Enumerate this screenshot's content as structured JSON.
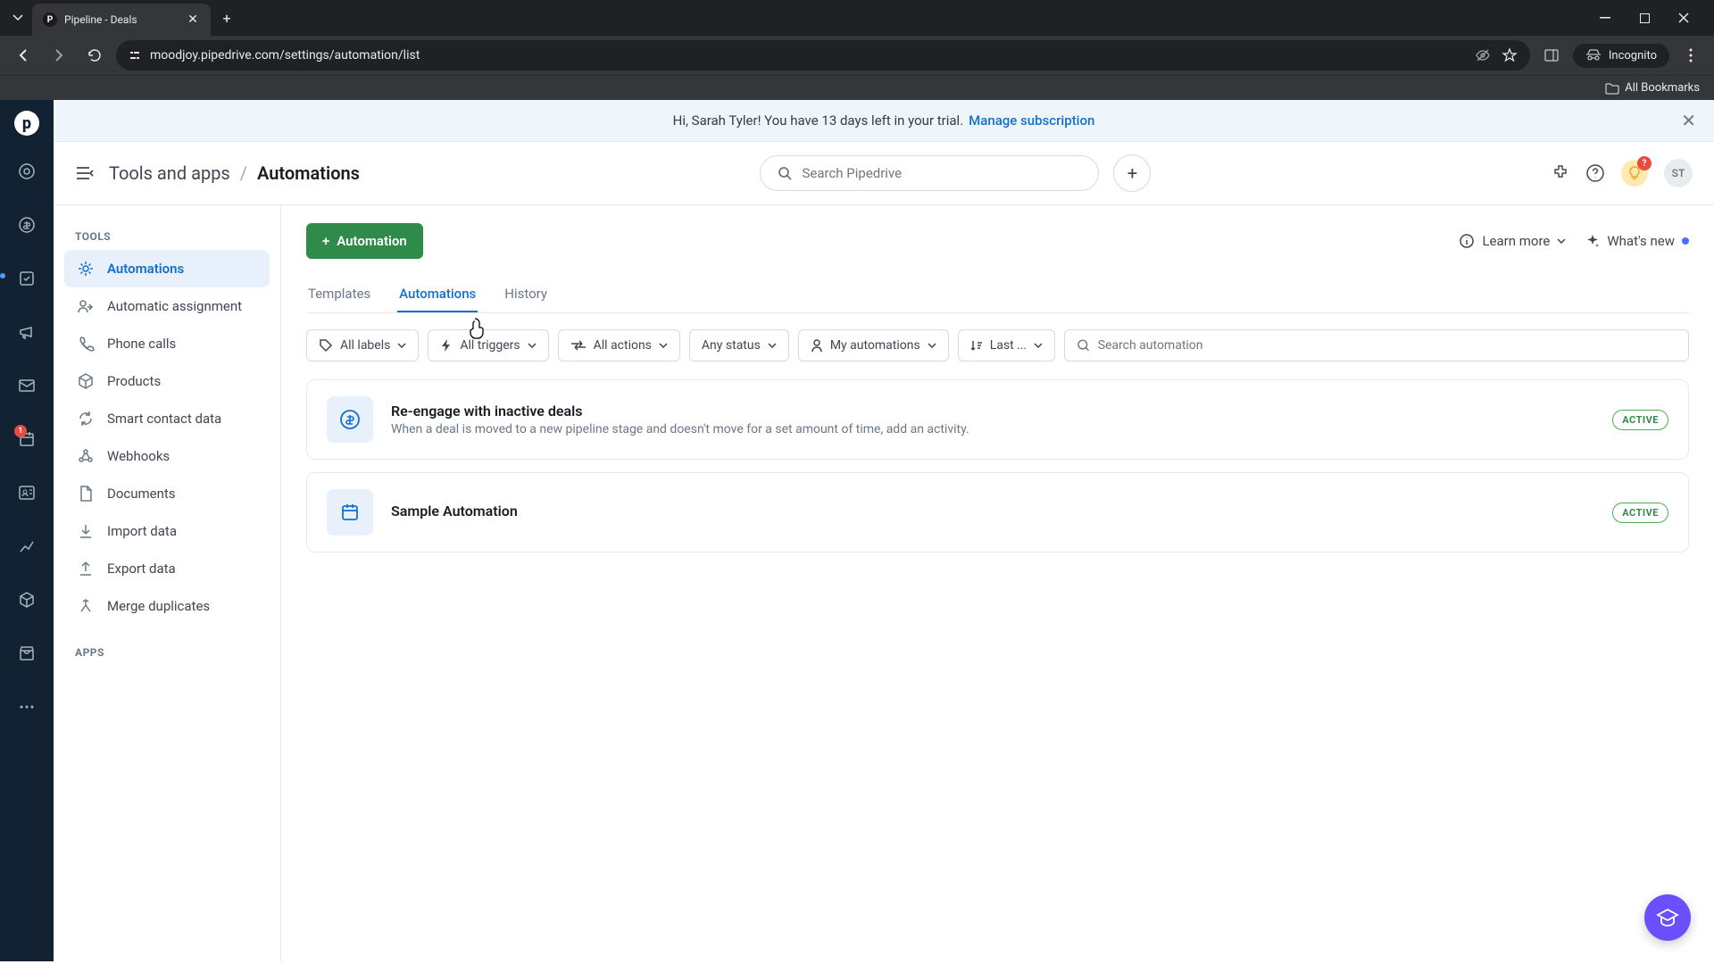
{
  "browser": {
    "tab_title": "Pipeline - Deals",
    "url": "moodjoy.pipedrive.com/settings/automation/list",
    "incognito_label": "Incognito",
    "bookmarks_label": "All Bookmarks"
  },
  "banner": {
    "text": "Hi, Sarah Tyler! You have 13 days left in your trial.",
    "link": "Manage subscription"
  },
  "topbar": {
    "breadcrumb_parent": "Tools and apps",
    "breadcrumb_current": "Automations",
    "search_placeholder": "Search Pipedrive",
    "avatar": "ST",
    "bulb_badge": "?"
  },
  "rail": {
    "badge_count": "1"
  },
  "sidebar": {
    "section_tools": "TOOLS",
    "section_apps": "APPS",
    "items": [
      {
        "label": "Automations"
      },
      {
        "label": "Automatic assignment"
      },
      {
        "label": "Phone calls"
      },
      {
        "label": "Products"
      },
      {
        "label": "Smart contact data"
      },
      {
        "label": "Webhooks"
      },
      {
        "label": "Documents"
      },
      {
        "label": "Import data"
      },
      {
        "label": "Export data"
      },
      {
        "label": "Merge duplicates"
      }
    ]
  },
  "main": {
    "new_button": "Automation",
    "learn_more": "Learn more",
    "whats_new": "What's new",
    "tabs": [
      {
        "label": "Templates"
      },
      {
        "label": "Automations"
      },
      {
        "label": "History"
      }
    ],
    "filters": {
      "labels": "All labels",
      "triggers": "All triggers",
      "actions": "All actions",
      "status": "Any status",
      "owner": "My automations",
      "sort": "Last ...",
      "search_placeholder": "Search automation"
    },
    "automations": [
      {
        "title": "Re-engage with inactive deals",
        "desc": "When a deal is moved to a new pipeline stage and doesn't move for a set amount of time, add an activity.",
        "status": "ACTIVE"
      },
      {
        "title": "Sample Automation",
        "desc": "",
        "status": "ACTIVE"
      }
    ]
  }
}
